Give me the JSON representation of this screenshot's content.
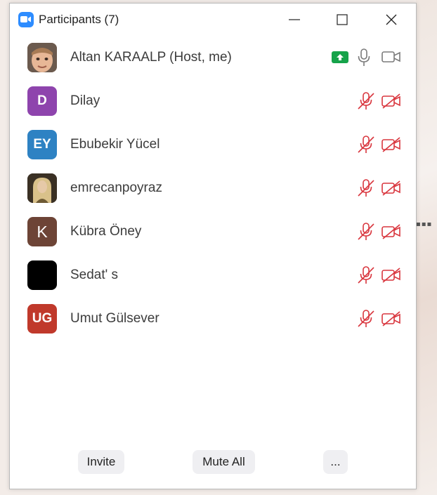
{
  "window": {
    "title": "Participants (7)"
  },
  "participants": [
    {
      "name": "Altan KARAALP (Host, me)",
      "avatar_type": "photo-child",
      "mic": "on",
      "video": "off",
      "sharing": true
    },
    {
      "name": "Dilay",
      "initials": "D",
      "avatar_color": "#8e44ad",
      "mic": "muted",
      "video": "off-stopped"
    },
    {
      "name": "Ebubekir Yücel",
      "initials": "EY",
      "avatar_color": "#2e82c3",
      "mic": "muted",
      "video": "off-stopped"
    },
    {
      "name": "emrecanpoyraz",
      "avatar_type": "photo-portrait",
      "mic": "muted",
      "video": "off-stopped"
    },
    {
      "name": "Kübra Öney",
      "initials": "K",
      "avatar_color": "#6d4436",
      "mic": "muted",
      "video": "off-stopped"
    },
    {
      "name": "Sedat' s",
      "initials": "",
      "avatar_color": "#000000",
      "mic": "muted",
      "video": "off-stopped"
    },
    {
      "name": "Umut Gülsever",
      "initials": "UG",
      "avatar_color": "#c0392b",
      "mic": "muted",
      "video": "off-stopped"
    }
  ],
  "footer": {
    "invite": "Invite",
    "mute_all": "Mute All",
    "more": "..."
  },
  "colors": {
    "accent": "#2d8cff",
    "muted_red": "#d9363e",
    "share_green": "#16a34a",
    "icon_gray": "#7a7a7a"
  }
}
